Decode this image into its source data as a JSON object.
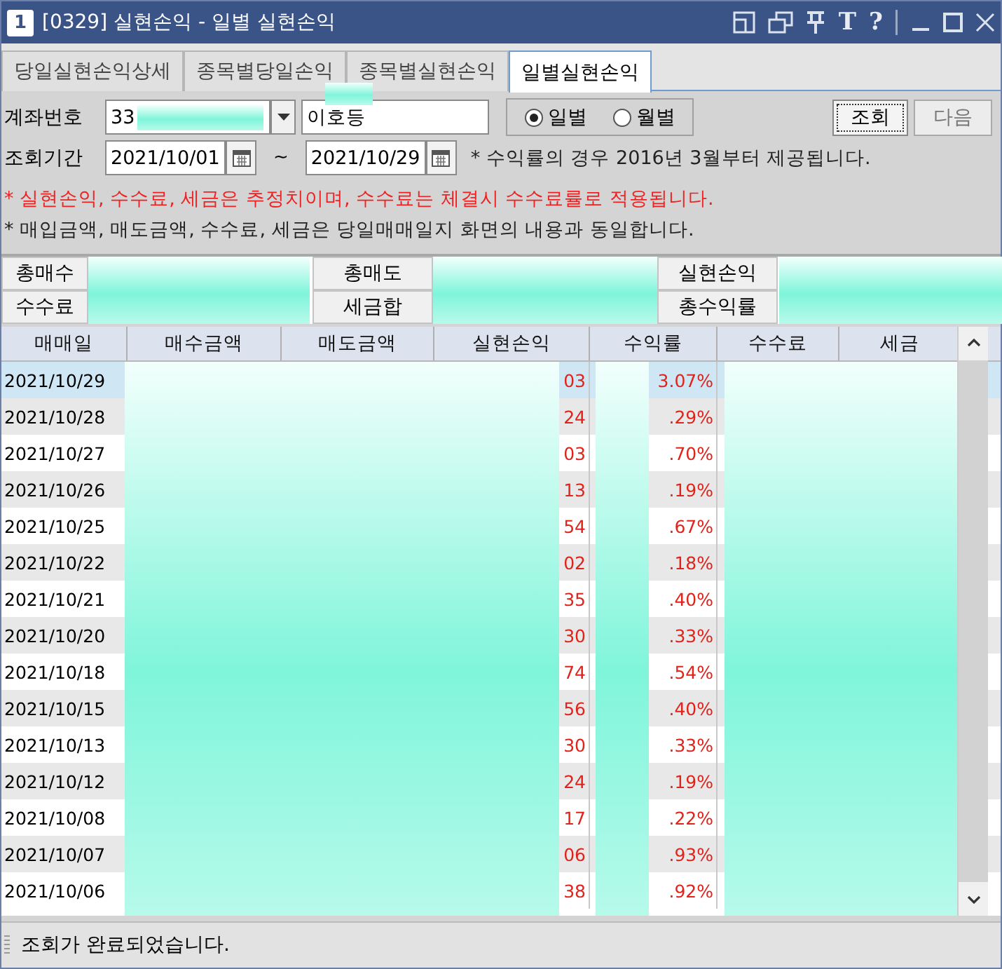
{
  "window": {
    "badge": "1",
    "title": "[0329] 실현손익 - 일별 실현손익",
    "tools": [
      "T",
      "?"
    ]
  },
  "tabs": [
    {
      "label": "당일실현손익상세",
      "selected": false
    },
    {
      "label": "종목별당일손익",
      "selected": false
    },
    {
      "label": "종목별실현손익",
      "selected": false
    },
    {
      "label": "일별실현손익",
      "selected": true
    }
  ],
  "form": {
    "account_label": "계좌번호",
    "account_value": "33",
    "name_value": "이호등",
    "periods": [
      {
        "label": "일별",
        "selected": true
      },
      {
        "label": "월별",
        "selected": false
      }
    ],
    "buttons": [
      "조회",
      "다음"
    ],
    "range_label": "조회기간",
    "date_from": "2021/10/01",
    "range_sep": "~",
    "date_to": "2021/10/29",
    "notes": [
      {
        "text": "* 수익률의 경우 2016년 3월부터 제공됩니다.",
        "kind": "plain"
      },
      {
        "text": "* 실현손익, 수수료, 세금은 추정치이며, 수수료는 체결시 수수료률로 적용됩니다.",
        "kind": "warning"
      },
      {
        "text": "* 매입금액, 매도금액, 수수료, 세금은 당일매매일지 화면의 내용과 동일합니다.",
        "kind": "plain"
      }
    ]
  },
  "summary": [
    [
      "총매수",
      "총매도",
      "실현손익"
    ],
    [
      "수수료",
      "세금합",
      "총수익률"
    ]
  ],
  "table": {
    "columns": [
      "매매일",
      "매수금액",
      "매도금액",
      "실현손익",
      "수익률",
      "수수료",
      "세금"
    ],
    "rows": [
      {
        "date": "2021/10/29",
        "pnl": "03",
        "rate": "3.07%",
        "selected": true
      },
      {
        "date": "2021/10/28",
        "pnl": "24",
        "rate": ".29%",
        "selected": false
      },
      {
        "date": "2021/10/27",
        "pnl": "03",
        "rate": ".70%",
        "selected": false
      },
      {
        "date": "2021/10/26",
        "pnl": "13",
        "rate": ".19%",
        "selected": false
      },
      {
        "date": "2021/10/25",
        "pnl": "54",
        "rate": ".67%",
        "selected": false
      },
      {
        "date": "2021/10/22",
        "pnl": "02",
        "rate": ".18%",
        "selected": false
      },
      {
        "date": "2021/10/21",
        "pnl": "35",
        "rate": ".40%",
        "selected": false
      },
      {
        "date": "2021/10/20",
        "pnl": "30",
        "rate": ".33%",
        "selected": false
      },
      {
        "date": "2021/10/18",
        "pnl": "74",
        "rate": ".54%",
        "selected": false
      },
      {
        "date": "2021/10/15",
        "pnl": "56",
        "rate": ".40%",
        "selected": false
      },
      {
        "date": "2021/10/13",
        "pnl": "30",
        "rate": ".33%",
        "selected": false
      },
      {
        "date": "2021/10/12",
        "pnl": "24",
        "rate": ".19%",
        "selected": false
      },
      {
        "date": "2021/10/08",
        "pnl": "17",
        "rate": ".22%",
        "selected": false
      },
      {
        "date": "2021/10/07",
        "pnl": "06",
        "rate": ".93%",
        "selected": false
      },
      {
        "date": "2021/10/06",
        "pnl": "38",
        "rate": ".92%",
        "selected": false
      }
    ]
  },
  "status_bar": "조회가 완료되었습니다."
}
